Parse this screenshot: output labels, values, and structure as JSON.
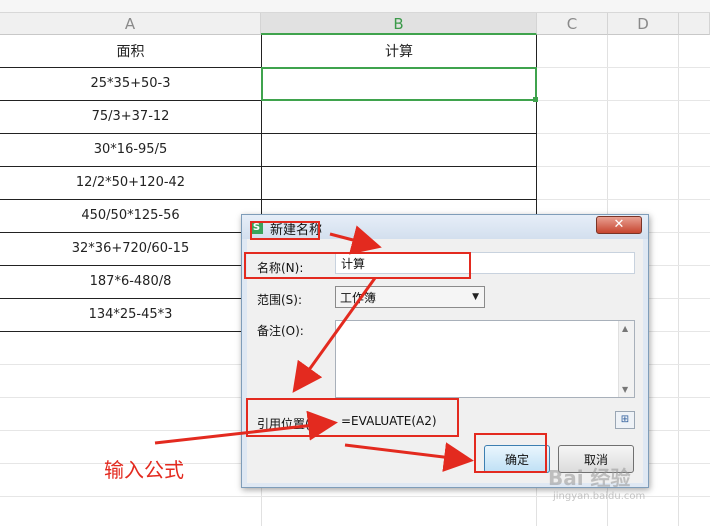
{
  "sheet": {
    "columns": [
      "A",
      "B",
      "C",
      "D"
    ],
    "headers": {
      "a": "面积",
      "b": "计算"
    },
    "rows": [
      "25*35+50-3",
      "75/3+37-12",
      "30*16-95/5",
      "12/2*50+120-42",
      "450/50*125-56",
      "32*36+720/60-15",
      "187*6-480/8",
      "134*25-45*3"
    ]
  },
  "dialog": {
    "title": "新建名称",
    "close": "✕",
    "name_label": "名称(N):",
    "name_value": "计算",
    "scope_label": "范围(S):",
    "scope_value": "工作簿",
    "comment_label": "备注(O):",
    "ref_label": "引用位置(R):",
    "ref_value": "=EVALUATE(A2)",
    "ok_label": "确定",
    "cancel_label": "取消"
  },
  "annotation": {
    "text": "输入公式",
    "color": "#e32a1f"
  },
  "watermark": {
    "text": "Bai 经验",
    "sub": "jingyan.baidu.com"
  }
}
